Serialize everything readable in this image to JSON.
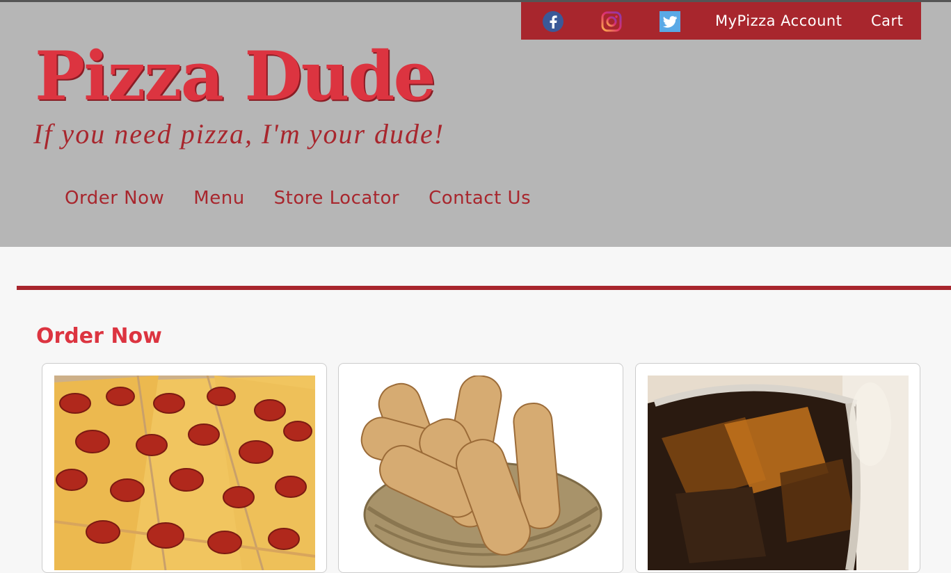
{
  "header": {
    "social": [
      {
        "icon": "facebook-icon",
        "color": "#3b5998"
      },
      {
        "icon": "instagram-icon",
        "color": "#e1306c"
      },
      {
        "icon": "twitter-icon",
        "color": "#1da1f2"
      }
    ],
    "account_label": "MyPizza Account",
    "cart_label": "Cart",
    "brand": "Pizza Dude",
    "tagline": "If you need pizza, I'm your dude!",
    "nav": [
      "Order Now",
      "Menu",
      "Store Locator",
      "Contact Us"
    ]
  },
  "main": {
    "section_title": "Order Now",
    "cards": [
      {
        "image": "pepperoni-pizza-photo"
      },
      {
        "image": "breadsticks-basket-photo"
      },
      {
        "image": "soda-with-ice-photo"
      }
    ]
  },
  "colors": {
    "accent": "#a8262d",
    "brand_red": "#dc3440",
    "header_bg": "#b6b6b6",
    "page_bg": "#f7f7f7"
  }
}
